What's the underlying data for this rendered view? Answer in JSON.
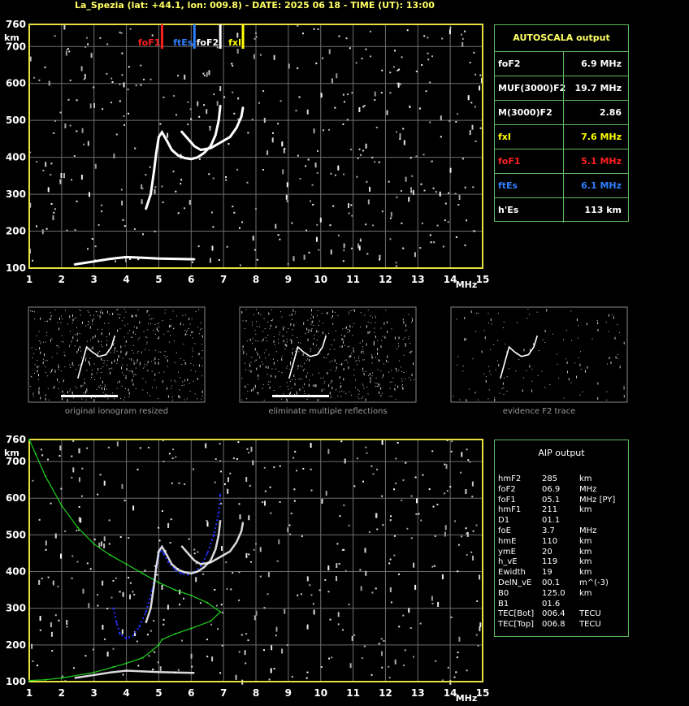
{
  "header": {
    "title": "La_Spezia (lat: +44.1, lon: 009.8) - DATE: 2025 06 18 - TIME (UT): 13:00"
  },
  "colors": {
    "axis": "#e8e040",
    "grid": "#6e6e6e",
    "border": "#5dbb5d",
    "title": "#ffff66",
    "foF1": "#ff2020",
    "ftEs": "#2f7fff",
    "foF2": "#ffffff",
    "fxI": "#ffff00",
    "profile": "#1fd11f",
    "aipTrace": "#2233ff"
  },
  "chart_data": [
    {
      "type": "scatter",
      "title": "",
      "xlabel": "MHz",
      "ylabel": "km",
      "xlim": [
        1,
        15
      ],
      "ylim": [
        100,
        760
      ],
      "xticks": [
        "1",
        "2",
        "3",
        "4",
        "5",
        "6",
        "7",
        "8",
        "9",
        "10",
        "11",
        "12",
        "13",
        "14",
        "15"
      ],
      "yticks": [
        "100",
        "200",
        "300",
        "400",
        "500",
        "600",
        "700",
        "760"
      ],
      "grid": true,
      "markers": [
        {
          "label": "foF1",
          "x": 5.1,
          "color": "#ff2020"
        },
        {
          "label": "ftEs",
          "x": 6.1,
          "color": "#2f7fff"
        },
        {
          "label": "foF2",
          "x": 6.9,
          "color": "#ffffff"
        },
        {
          "label": "fxI",
          "x": 7.6,
          "color": "#ffff00"
        }
      ],
      "series": [
        {
          "values_xy": [
            [
              4.6,
              260
            ],
            [
              4.75,
              300
            ],
            [
              4.85,
              360
            ],
            [
              4.92,
              410
            ],
            [
              5.0,
              455
            ],
            [
              5.1,
              468
            ],
            [
              5.25,
              445
            ],
            [
              5.4,
              420
            ],
            [
              5.6,
              405
            ],
            [
              5.8,
              398
            ],
            [
              6.0,
              395
            ],
            [
              6.2,
              400
            ],
            [
              6.4,
              412
            ],
            [
              6.6,
              430
            ],
            [
              6.75,
              460
            ],
            [
              6.85,
              500
            ],
            [
              6.9,
              540
            ]
          ]
        },
        {
          "values_xy": [
            [
              5.7,
              470
            ],
            [
              5.9,
              450
            ],
            [
              6.1,
              430
            ],
            [
              6.3,
              420
            ],
            [
              6.6,
              425
            ],
            [
              6.9,
              440
            ],
            [
              7.2,
              455
            ],
            [
              7.4,
              480
            ],
            [
              7.55,
              510
            ],
            [
              7.6,
              535
            ]
          ]
        },
        {
          "values_xy": [
            [
              2.4,
              110
            ],
            [
              3.0,
              118
            ],
            [
              3.5,
              125
            ],
            [
              4.0,
              130
            ],
            [
              4.5,
              128
            ],
            [
              5.0,
              126
            ],
            [
              5.5,
              125
            ],
            [
              6.1,
              124
            ]
          ]
        }
      ]
    },
    {
      "type": "scatter",
      "title": "",
      "xlabel": "MHz",
      "ylabel": "km",
      "xlim": [
        1,
        15
      ],
      "ylim": [
        100,
        760
      ],
      "xticks": [
        "1",
        "2",
        "3",
        "4",
        "5",
        "6",
        "7",
        "8",
        "9",
        "10",
        "11",
        "12",
        "13",
        "14",
        "15"
      ],
      "yticks": [
        "100",
        "200",
        "300",
        "400",
        "500",
        "600",
        "700",
        "760"
      ],
      "grid": true,
      "series": [
        {
          "values_xy": [
            [
              1.0,
              760
            ],
            [
              1.2,
              720
            ],
            [
              1.5,
              660
            ],
            [
              2.0,
              580
            ],
            [
              2.5,
              520
            ],
            [
              3.0,
              475
            ],
            [
              3.5,
              445
            ],
            [
              4.0,
              420
            ],
            [
              4.5,
              395
            ],
            [
              5.0,
              370
            ],
            [
              5.5,
              350
            ],
            [
              6.0,
              335
            ],
            [
              6.5,
              315
            ],
            [
              6.9,
              290
            ],
            [
              6.6,
              265
            ],
            [
              6.0,
              245
            ],
            [
              5.5,
              230
            ],
            [
              5.1,
              215
            ],
            [
              5.0,
              200
            ],
            [
              4.8,
              185
            ],
            [
              4.5,
              165
            ],
            [
              4.0,
              150
            ],
            [
              3.6,
              140
            ],
            [
              3.0,
              125
            ],
            [
              2.0,
              110
            ],
            [
              1.5,
              105
            ],
            [
              1.0,
              103
            ]
          ]
        },
        {
          "values_xy": [
            [
              3.6,
              300
            ],
            [
              3.7,
              260
            ],
            [
              3.8,
              230
            ],
            [
              4.0,
              218
            ],
            [
              4.2,
              225
            ],
            [
              4.4,
              250
            ],
            [
              4.6,
              290
            ],
            [
              4.8,
              350
            ],
            [
              4.95,
              420
            ],
            [
              5.05,
              460
            ],
            [
              5.15,
              450
            ],
            [
              5.3,
              425
            ],
            [
              5.5,
              405
            ],
            [
              5.7,
              395
            ],
            [
              5.9,
              392
            ],
            [
              6.1,
              398
            ],
            [
              6.3,
              415
            ],
            [
              6.5,
              450
            ],
            [
              6.7,
              500
            ],
            [
              6.85,
              560
            ],
            [
              6.9,
              610
            ]
          ]
        }
      ]
    }
  ],
  "autoscala": {
    "title": "AUTOSCALA output",
    "rows": [
      {
        "key": "foF2",
        "value": "6.9 MHz",
        "color": "#ffffff"
      },
      {
        "key": "MUF(3000)F2",
        "value": "19.7 MHz",
        "color": "#ffffff"
      },
      {
        "key": "M(3000)F2",
        "value": "2.86",
        "color": "#ffffff"
      },
      {
        "key": "fxI",
        "value": "7.6 MHz",
        "color": "#ffff00"
      },
      {
        "key": "foF1",
        "value": "5.1 MHz",
        "color": "#ff2020"
      },
      {
        "key": "ftEs",
        "value": "6.1 MHz",
        "color": "#2f7fff"
      },
      {
        "key": "h'Es",
        "value": "113    km",
        "color": "#ffffff"
      }
    ]
  },
  "thumbs": [
    {
      "caption": "original ionogram resized"
    },
    {
      "caption": "eliminate multiple reflections"
    },
    {
      "caption": "evidence F2 trace"
    }
  ],
  "aip": {
    "title": "AIP output",
    "rows": [
      {
        "k": "hmF2",
        "v": "285",
        "u": "km"
      },
      {
        "k": "foF2",
        "v": "06.9",
        "u": "MHz"
      },
      {
        "k": "foF1",
        "v": "05.1",
        "u": "MHz    [PY]"
      },
      {
        "k": "hmF1",
        "v": "211",
        "u": "km"
      },
      {
        "k": "D1",
        "v": "01.1",
        "u": ""
      },
      {
        "k": "foE",
        "v": "3.7",
        "u": "MHz"
      },
      {
        "k": "hmE",
        "v": "110",
        "u": "km"
      },
      {
        "k": "ymE",
        "v": "20",
        "u": "km"
      },
      {
        "k": "h_vE",
        "v": "119",
        "u": "km"
      },
      {
        "k": "Ewidth",
        "v": "19",
        "u": "km"
      },
      {
        "k": "DelN_vE",
        "v": "00.1",
        "u": "m^(-3)"
      },
      {
        "k": "B0",
        "v": "125.0",
        "u": "km"
      },
      {
        "k": "B1",
        "v": "01.6",
        "u": ""
      },
      {
        "k": "TEC[Bot]",
        "v": "006.4",
        "u": "TECU"
      },
      {
        "k": "TEC[Top]",
        "v": "006.8",
        "u": "TECU"
      }
    ]
  }
}
